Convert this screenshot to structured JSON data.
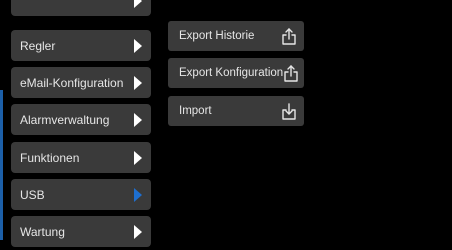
{
  "menu": {
    "items": [
      {
        "label": "",
        "active": false
      },
      {
        "label": "Regler",
        "active": false
      },
      {
        "label": "eMail-Konfiguration",
        "active": false
      },
      {
        "label": "Alarmverwaltung",
        "active": false
      },
      {
        "label": "Funktionen",
        "active": false
      },
      {
        "label": "USB",
        "active": true
      },
      {
        "label": "Wartung",
        "active": false
      }
    ]
  },
  "submenu": {
    "items": [
      {
        "label": "Export Historie",
        "icon": "upload-icon"
      },
      {
        "label": "Export Konfiguration",
        "icon": "upload-icon"
      },
      {
        "label": "Import",
        "icon": "download-icon"
      }
    ]
  },
  "colors": {
    "background": "#000000",
    "item_bg": "#3a3a3a",
    "text": "#e6e6e6",
    "accent": "#1e6fd0"
  }
}
